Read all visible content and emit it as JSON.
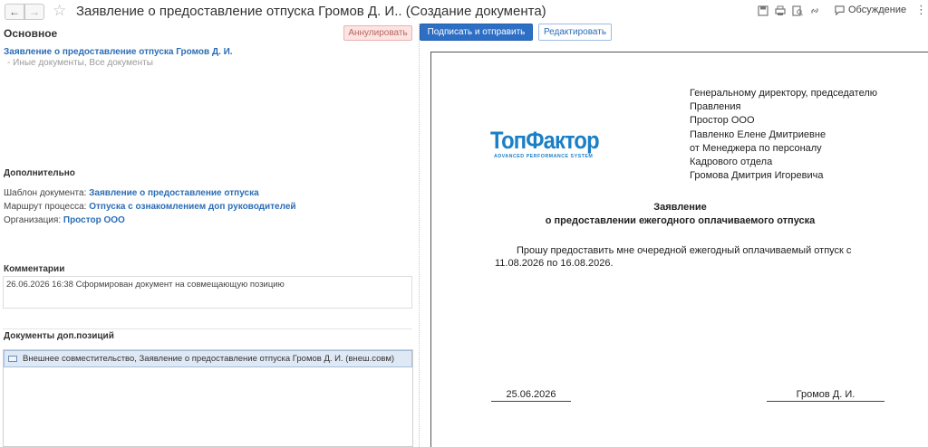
{
  "window": {
    "title": "Заявление о предоставление отпуска Громов Д. И.. (Создание документа)",
    "back_icon": "←",
    "forward_icon": "→",
    "star_icon": "☆",
    "discuss_label": "Обсуждение",
    "more_icon": "⋮"
  },
  "left": {
    "section_main": "Основное",
    "annul_button": "Аннулировать",
    "doc_link": "Заявление о предоставление отпуска Громов Д. И.",
    "doc_sub": "- Иные документы, Все документы",
    "section_extra": "Дополнительно",
    "template_label": "Шаблон документа:",
    "template_value": "Заявление о предоставление отпуска",
    "route_label": "Маршрут процесса:",
    "route_value": "Отпуска с ознакомлением доп руководителей",
    "org_label": "Организация:",
    "org_value": "Простор ООО",
    "section_comments": "Комментарии",
    "comment_text": "26.06.2026 16:38 Сформирован документ на совмещающую позицию",
    "section_docs": "Документы доп.позиций",
    "docs_row": "Внешнее совместительство, Заявление о предоставление отпуска Громов Д. И. (внеш.совм)"
  },
  "right": {
    "sign_button": "Подписать и отправить",
    "edit_button": "Редактировать"
  },
  "document": {
    "addressee": [
      "Генеральному директору, председателю",
      "Правления",
      "Простор ООО",
      "Павленко Елене Дмитриевне",
      "от Менеджера по персоналу",
      "Кадрового отдела",
      "Громова Дмитрия Игоревича"
    ],
    "logo_main": "ТопФактор",
    "logo_sub": "ADVANCED PERFORMANCE SYSTEM",
    "heading_line1": "Заявление",
    "heading_line2": "о предоставлении ежегодного оплачиваемого отпуска",
    "body_line1": "Прошу предоставить мне очередной ежегодный оплачиваемый отпуск с",
    "body_line2": "11.08.2026 по 16.08.2026.",
    "date": "25.06.2026",
    "signer": "Громов Д. И."
  }
}
